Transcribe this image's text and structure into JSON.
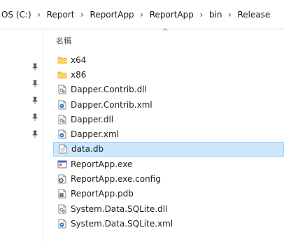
{
  "address_bar": {
    "crumbs": [
      "OS (C:)",
      "Report",
      "ReportApp",
      "ReportApp",
      "bin",
      "Release"
    ]
  },
  "column_header": {
    "name_label": "名稱",
    "sort_indicator": "^"
  },
  "files": [
    {
      "name": "x64",
      "icon": "folder-icon"
    },
    {
      "name": "x86",
      "icon": "folder-icon"
    },
    {
      "name": "Dapper.Contrib.dll",
      "icon": "dll-file-icon"
    },
    {
      "name": "Dapper.Contrib.xml",
      "icon": "xml-file-icon"
    },
    {
      "name": "Dapper.dll",
      "icon": "dll-file-icon"
    },
    {
      "name": "Dapper.xml",
      "icon": "xml-file-icon"
    },
    {
      "name": "data.db",
      "icon": "db-file-icon",
      "selected": true
    },
    {
      "name": "ReportApp.exe",
      "icon": "exe-file-icon"
    },
    {
      "name": "ReportApp.exe.config",
      "icon": "config-file-icon"
    },
    {
      "name": "ReportApp.pdb",
      "icon": "pdb-file-icon"
    },
    {
      "name": "System.Data.SQLite.dll",
      "icon": "dll-file-icon"
    },
    {
      "name": "System.Data.SQLite.xml",
      "icon": "xml-file-icon"
    }
  ],
  "colors": {
    "selection_bg": "#cce8ff",
    "selection_border": "#99d1ff",
    "folder": "#f7c948"
  }
}
